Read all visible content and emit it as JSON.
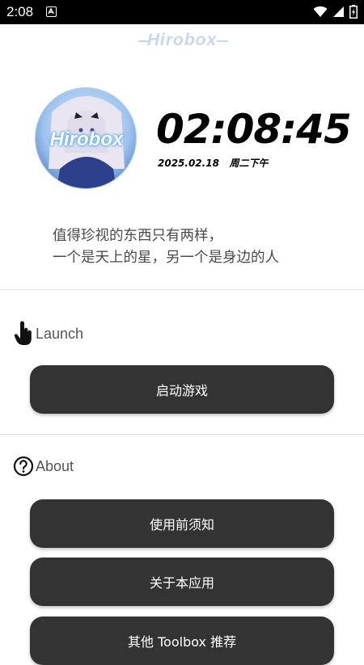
{
  "status_bar": {
    "time": "2:08"
  },
  "logo": {
    "text": "Hirobox"
  },
  "avatar": {
    "overlay_text": "Hirobox"
  },
  "clock": {
    "time": "02:08:45",
    "date": "2025.02.18",
    "weekday": "周二下午"
  },
  "quote": {
    "line1": "值得珍视的东西只有两样，",
    "line2": "一个是天上的星，另一个是身边的人"
  },
  "sections": {
    "launch": {
      "label": "Launch",
      "icon": "hand-pointer-icon",
      "buttons": [
        "启动游戏"
      ]
    },
    "about": {
      "label": "About",
      "icon": "question-circle-icon",
      "buttons": [
        "使用前须知",
        "关于本应用",
        "其他 Toolbox 推荐"
      ]
    }
  },
  "colors": {
    "button_bg": "#333333",
    "logo": "#c7d7f2",
    "status_bar": "#000000"
  }
}
